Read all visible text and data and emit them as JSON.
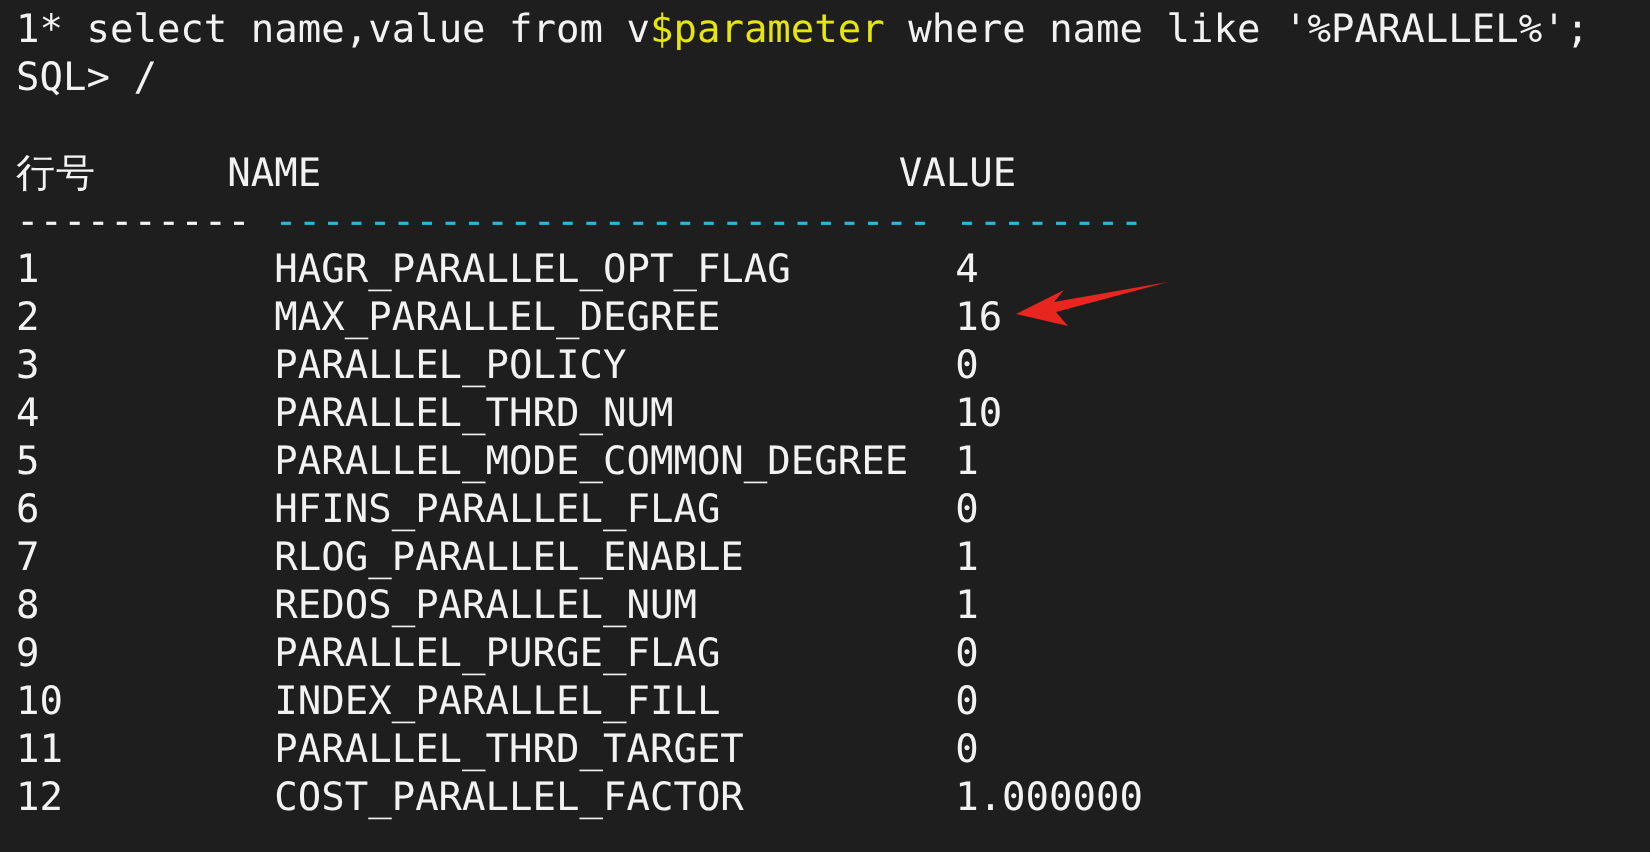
{
  "command_line": [
    {
      "text": "1* select name,value from v",
      "color": "#f2f2f2"
    },
    {
      "text": "$parameter",
      "color": "#e5e510"
    },
    {
      "text": " where name like '%PARALLEL%';",
      "color": "#f2f2f2"
    }
  ],
  "prompt_line": "SQL> /",
  "table": {
    "columns": [
      "行号",
      "NAME",
      "VALUE"
    ],
    "separator": [
      {
        "text": "----------",
        "color": "#f2f2f2"
      },
      {
        "text": "----------------------------",
        "color": "#29b8db"
      },
      {
        "text": "--------",
        "color": "#29b8db"
      }
    ],
    "rows": [
      {
        "row": "1",
        "name": "HAGR_PARALLEL_OPT_FLAG",
        "value": "4"
      },
      {
        "row": "2",
        "name": "MAX_PARALLEL_DEGREE",
        "value": "16"
      },
      {
        "row": "3",
        "name": "PARALLEL_POLICY",
        "value": "0"
      },
      {
        "row": "4",
        "name": "PARALLEL_THRD_NUM",
        "value": "10"
      },
      {
        "row": "5",
        "name": "PARALLEL_MODE_COMMON_DEGREE",
        "value": "1"
      },
      {
        "row": "6",
        "name": "HFINS_PARALLEL_FLAG",
        "value": "0"
      },
      {
        "row": "7",
        "name": "RLOG_PARALLEL_ENABLE",
        "value": "1"
      },
      {
        "row": "8",
        "name": "REDOS_PARALLEL_NUM",
        "value": "1"
      },
      {
        "row": "9",
        "name": "PARALLEL_PURGE_FLAG",
        "value": "0"
      },
      {
        "row": "10",
        "name": "INDEX_PARALLEL_FILL",
        "value": "0"
      },
      {
        "row": "11",
        "name": "PARALLEL_THRD_TARGET",
        "value": "0"
      },
      {
        "row": "12",
        "name": "COST_PARALLEL_FACTOR",
        "value": "1.000000"
      }
    ]
  }
}
